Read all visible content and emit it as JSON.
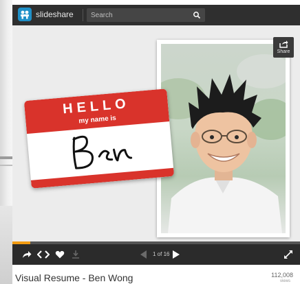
{
  "brand": {
    "name": "slideshare",
    "accent": "#1f90c8"
  },
  "search": {
    "placeholder": "Search",
    "icon": "search-icon"
  },
  "player": {
    "share_label": "Share",
    "slide_position": "1 of 16",
    "progress_fraction": 0.0625,
    "progress_color": "#f39c12",
    "controls": [
      "share-arrow-icon",
      "embed-icon",
      "heart-icon",
      "download-icon",
      "prev-icon",
      "next-icon",
      "fullscreen-icon"
    ]
  },
  "slide": {
    "nametag": {
      "hello": "HELLO",
      "subtitle": "my name is",
      "signature": "Ben",
      "color": "#d9332b"
    }
  },
  "footer": {
    "title": "Visual Resume - Ben Wong",
    "views": "112,008",
    "views_label": "views"
  }
}
